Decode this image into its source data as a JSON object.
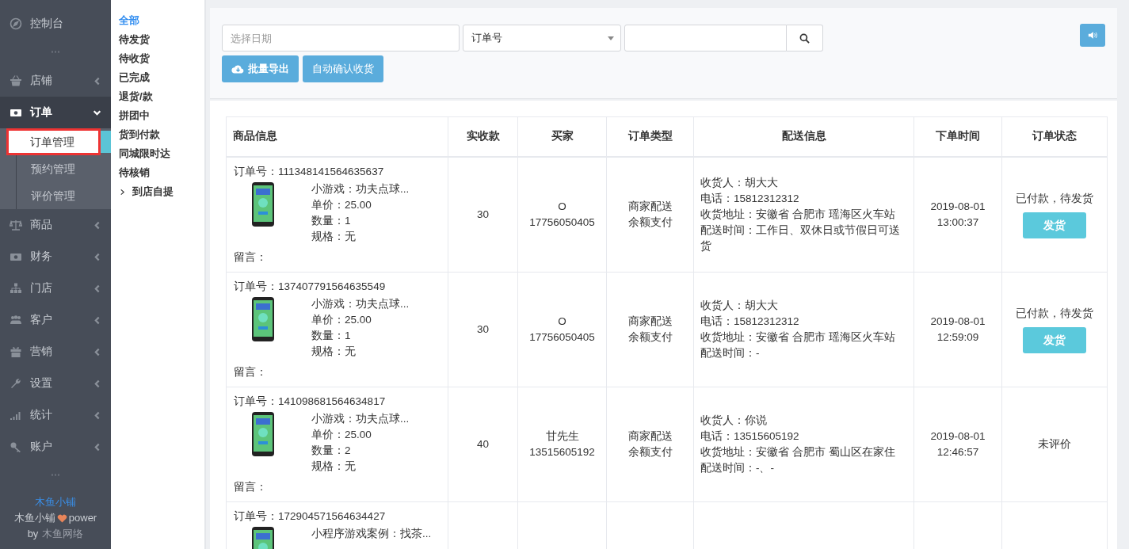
{
  "sidebar": {
    "items": [
      {
        "label": "控制台"
      },
      {
        "label": "店铺",
        "expanded": false
      },
      {
        "label": "订单",
        "expanded": true,
        "children": [
          {
            "label": "订单管理",
            "selected": true
          },
          {
            "label": "预约管理",
            "selected": false
          },
          {
            "label": "评价管理",
            "selected": false
          }
        ]
      },
      {
        "label": "商品",
        "expanded": false
      },
      {
        "label": "财务",
        "expanded": false
      },
      {
        "label": "门店",
        "expanded": false
      },
      {
        "label": "客户",
        "expanded": false
      },
      {
        "label": "营销",
        "expanded": false
      },
      {
        "label": "设置",
        "expanded": false
      },
      {
        "label": "统计",
        "expanded": false
      },
      {
        "label": "账户",
        "expanded": false
      }
    ],
    "footer": {
      "brand": "木鱼小铺",
      "power": "木鱼小铺",
      "power_suffix": "power",
      "by": "by",
      "company": "木鱼网络"
    }
  },
  "subnav": {
    "items": [
      {
        "label": "全部",
        "selected": true
      },
      {
        "label": "待发货",
        "selected": false
      },
      {
        "label": "待收货",
        "selected": false
      },
      {
        "label": "已完成",
        "selected": false
      },
      {
        "label": "退货/款",
        "selected": false
      },
      {
        "label": "拼团中",
        "selected": false
      },
      {
        "label": "货到付款",
        "selected": false
      },
      {
        "label": "同城限时达",
        "selected": false
      },
      {
        "label": "待核销",
        "selected": false
      },
      {
        "label": "到店自提",
        "selected": false,
        "expanded": false
      }
    ]
  },
  "filters": {
    "date": {
      "placeholder": "选择日期"
    },
    "field_select": {
      "value": "订单号"
    },
    "buttons": [
      {
        "kind": "export",
        "label": "批量导出"
      },
      {
        "kind": "plain",
        "label": "自动确认收货"
      }
    ]
  },
  "table": {
    "columns": [
      "商品信息",
      "实收款",
      "买家",
      "订单类型",
      "配送信息",
      "下单时间",
      "订单状态"
    ],
    "rows": [
      {
        "order_no": "订单号：111348141564635637",
        "product": [
          "小游戏：功夫点球...",
          "单价：25.00",
          "数量：1",
          "规格：无"
        ],
        "note": "留言：",
        "amount": "30",
        "buyer": [
          "O",
          "17756050405"
        ],
        "type": [
          "商家配送",
          "余额支付"
        ],
        "delivery": [
          "收货人：胡大大",
          "电话：15812312312",
          "收货地址：安徽省 合肥市 瑶海区火车站",
          "配送时间：工作日、双休日或节假日可送货"
        ],
        "time": [
          "2019-08-01",
          "13:00:37"
        ],
        "status": "已付款，待发货",
        "action": "发货"
      },
      {
        "order_no": "订单号：137407791564635549",
        "product": [
          "小游戏：功夫点球...",
          "单价：25.00",
          "数量：1",
          "规格：无"
        ],
        "note": "留言：",
        "amount": "30",
        "buyer": [
          "O",
          "17756050405"
        ],
        "type": [
          "商家配送",
          "余额支付"
        ],
        "delivery": [
          "收货人：胡大大",
          "电话：15812312312",
          "收货地址：安徽省 合肥市 瑶海区火车站",
          "配送时间：-"
        ],
        "time": [
          "2019-08-01",
          "12:59:09"
        ],
        "status": "已付款，待发货",
        "action": "发货"
      },
      {
        "order_no": "订单号：141098681564634817",
        "product": [
          "小游戏：功夫点球...",
          "单价：25.00",
          "数量：2",
          "规格：无"
        ],
        "note": "留言：",
        "amount": "40",
        "buyer": [
          "甘先生",
          "13515605192"
        ],
        "type": [
          "商家配送",
          "余额支付"
        ],
        "delivery": [
          "收货人：你说",
          "电话：13515605192",
          "收货地址：安徽省 合肥市 蜀山区在家住",
          "配送时间：-、-"
        ],
        "time": [
          "2019-08-01",
          "12:46:57"
        ],
        "status": "未评价"
      },
      {
        "order_no": "订单号：172904571564634427",
        "product": [
          "小程序游戏案例：找茶..."
        ]
      }
    ]
  }
}
